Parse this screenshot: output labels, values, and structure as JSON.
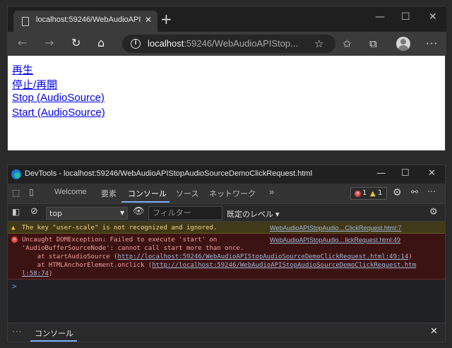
{
  "browser": {
    "tab_title": "localhost:59246/WebAudioAPISt...",
    "new_tab": "+",
    "url_host": "localhost",
    "url_rest": ":59246/WebAudioAPIStop...",
    "content_links": [
      "再生",
      "停止/再開",
      "Stop (AudioSource)",
      "Start (AudioSource)"
    ]
  },
  "devtools": {
    "title": "DevTools - localhost:59246/WebAudioAPIStopAudioSourceDemoClickRequest.html",
    "tabs": [
      "Welcome",
      "要素",
      "コンソール",
      "ソース",
      "ネットワーク",
      "»"
    ],
    "active_tab": "コンソール",
    "error_count": "1",
    "warning_count": "1",
    "context": "top",
    "filter_placeholder": "フィルター",
    "levels": "既定のレベル ▾",
    "warning": {
      "text": "The key \"user-scale\" is not recognized and ignored.",
      "source": "WebAudioAPIStopAudio…ClickRequest.html:7"
    },
    "error": {
      "line1": "Uncaught DOMException: Failed to execute 'start' on",
      "source": "WebAudioAPIStopAudio…lickRequest.html:49",
      "line2": "'AudioBufferSourceNode': cannot call start more than once.",
      "line3_prefix": "    at startAudioSource (",
      "line3_link": "http://localhost:59246/WebAudioAPIStopAudioSourceDemoClickRequest.html:49:14",
      "line3_suffix": ")",
      "line4_prefix": "    at HTMLAnchorElement.onclick (",
      "line4_link": "http://localhost:59246/WebAudioAPIStopAudioSourceDemoClickRequest.htm",
      "line5_link": "l:58:74",
      "line5_suffix": ")"
    },
    "prompt": ">",
    "drawer_more": "···",
    "drawer_tab": "コンソール"
  }
}
